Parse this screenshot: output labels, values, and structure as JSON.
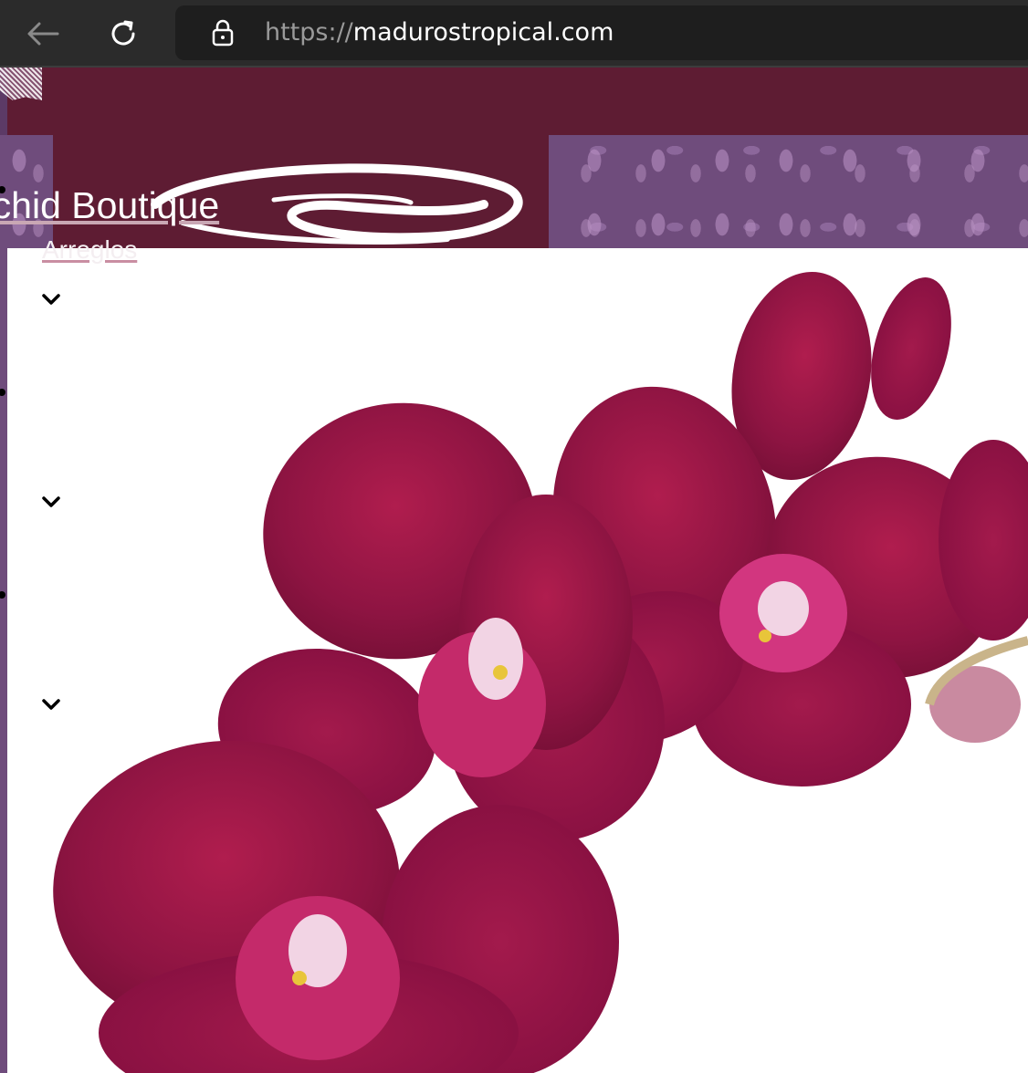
{
  "browser": {
    "url_scheme": "https://",
    "url_host": "madurostropical.com",
    "back_icon": "back-arrow-icon",
    "reload_icon": "reload-icon",
    "lock_icon": "lock-icon"
  },
  "site": {
    "title": "rchid Boutique"
  },
  "nav": {
    "items": [
      {
        "label": "Arreglos"
      },
      {
        "label": ""
      },
      {
        "label": ""
      }
    ]
  },
  "colors": {
    "header_band": "#5e1c33",
    "pattern": "#6f4c7c",
    "link_underline": "#c98ea2",
    "orchid": "#8e1442"
  }
}
